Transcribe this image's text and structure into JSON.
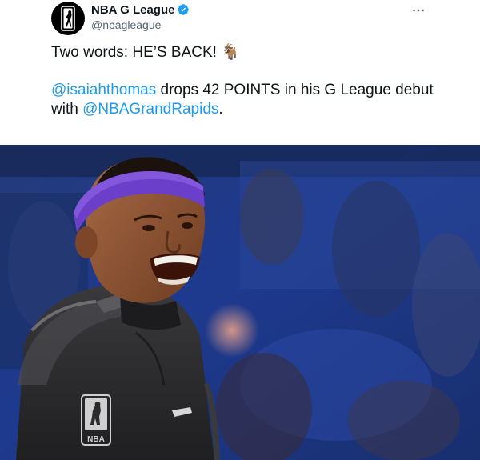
{
  "account": {
    "display_name": "NBA G League",
    "handle": "@nbagleague",
    "verified": true,
    "avatar_icon": "g-league-logo-icon",
    "brand_color": "#000000"
  },
  "menu": {
    "icon": "more-options-icon",
    "glyph": "···"
  },
  "tweet": {
    "line1": "Two words: HE’S BACK! 🐐",
    "mention1": "@isaiahthomas",
    "line2_rest": " drops 42 POINTS in his G League debut",
    "line3_prefix": "with ",
    "mention2": "@NBAGrandRapids",
    "line3_suffix": "."
  },
  "colors": {
    "text": "#0f1419",
    "secondary": "#536471",
    "link": "#1d9bf0",
    "verified_badge": "#1d9bf0"
  },
  "media": {
    "logo_text": "NBA",
    "jersey_color": "#2b2b2d",
    "headband_color": "#6b3fc9",
    "background_color": "#1e3a8f"
  }
}
